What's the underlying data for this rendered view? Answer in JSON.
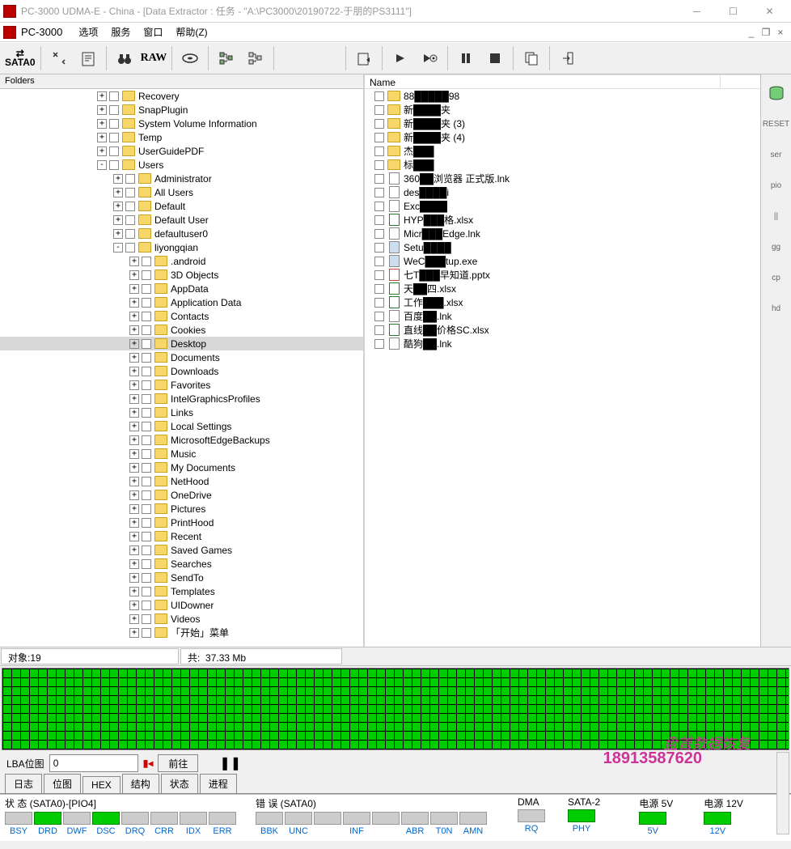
{
  "window": {
    "title": "PC-3000 UDMA-E - China - [Data Extractor : 任务 - \"A:\\PC3000\\20190722-于朋的PS3111\"]"
  },
  "menu": {
    "app_name": "PC-3000",
    "items": [
      "选项",
      "服务",
      "窗口",
      "帮助(Z)"
    ]
  },
  "toolbar": {
    "sata": "SATA0",
    "raw": "RAW"
  },
  "left_pane": {
    "header": "Folders",
    "tree": [
      {
        "indent": 120,
        "exp": "+",
        "label": "Recovery"
      },
      {
        "indent": 120,
        "exp": "+",
        "label": "SnapPlugin"
      },
      {
        "indent": 120,
        "exp": "+",
        "label": "System Volume Information"
      },
      {
        "indent": 120,
        "exp": "+",
        "label": "Temp"
      },
      {
        "indent": 120,
        "exp": "+",
        "label": "UserGuidePDF"
      },
      {
        "indent": 120,
        "exp": "-",
        "label": "Users"
      },
      {
        "indent": 140,
        "exp": "+",
        "label": "Administrator"
      },
      {
        "indent": 140,
        "exp": "+",
        "label": "All Users"
      },
      {
        "indent": 140,
        "exp": "+",
        "label": "Default"
      },
      {
        "indent": 140,
        "exp": "+",
        "label": "Default User"
      },
      {
        "indent": 140,
        "exp": "+",
        "label": "defaultuser0"
      },
      {
        "indent": 140,
        "exp": "-",
        "label": "liyongqian"
      },
      {
        "indent": 160,
        "exp": "+",
        "label": ".android"
      },
      {
        "indent": 160,
        "exp": "+",
        "label": "3D Objects"
      },
      {
        "indent": 160,
        "exp": "+",
        "label": "AppData"
      },
      {
        "indent": 160,
        "exp": "+",
        "label": "Application Data"
      },
      {
        "indent": 160,
        "exp": "+",
        "label": "Contacts"
      },
      {
        "indent": 160,
        "exp": "+",
        "label": "Cookies"
      },
      {
        "indent": 160,
        "exp": "+",
        "label": "Desktop",
        "selected": true
      },
      {
        "indent": 160,
        "exp": "+",
        "label": "Documents"
      },
      {
        "indent": 160,
        "exp": "+",
        "label": "Downloads"
      },
      {
        "indent": 160,
        "exp": "+",
        "label": "Favorites"
      },
      {
        "indent": 160,
        "exp": "+",
        "label": "IntelGraphicsProfiles"
      },
      {
        "indent": 160,
        "exp": "+",
        "label": "Links"
      },
      {
        "indent": 160,
        "exp": "+",
        "label": "Local Settings"
      },
      {
        "indent": 160,
        "exp": "+",
        "label": "MicrosoftEdgeBackups"
      },
      {
        "indent": 160,
        "exp": "+",
        "label": "Music"
      },
      {
        "indent": 160,
        "exp": "+",
        "label": "My Documents"
      },
      {
        "indent": 160,
        "exp": "+",
        "label": "NetHood"
      },
      {
        "indent": 160,
        "exp": "+",
        "label": "OneDrive"
      },
      {
        "indent": 160,
        "exp": "+",
        "label": "Pictures"
      },
      {
        "indent": 160,
        "exp": "+",
        "label": "PrintHood"
      },
      {
        "indent": 160,
        "exp": "+",
        "label": "Recent"
      },
      {
        "indent": 160,
        "exp": "+",
        "label": "Saved Games"
      },
      {
        "indent": 160,
        "exp": "+",
        "label": "Searches"
      },
      {
        "indent": 160,
        "exp": "+",
        "label": "SendTo"
      },
      {
        "indent": 160,
        "exp": "+",
        "label": "Templates"
      },
      {
        "indent": 160,
        "exp": "+",
        "label": "UIDowner"
      },
      {
        "indent": 160,
        "exp": "+",
        "label": "Videos"
      },
      {
        "indent": 160,
        "exp": "+",
        "label": "「开始」菜单"
      }
    ]
  },
  "right_pane": {
    "header": "Name",
    "items": [
      {
        "type": "folder",
        "label": "88█████98"
      },
      {
        "type": "folder",
        "label": "新████夹"
      },
      {
        "type": "folder",
        "label": "新████夹 (3)"
      },
      {
        "type": "folder",
        "label": "新████夹 (4)"
      },
      {
        "type": "folder",
        "label": "杰███"
      },
      {
        "type": "folder",
        "label": "标███"
      },
      {
        "type": "file",
        "label": "360██浏览器 正式版.lnk"
      },
      {
        "type": "file",
        "label": "des████i"
      },
      {
        "type": "file",
        "label": "Exc████"
      },
      {
        "type": "xlsx",
        "label": "HYP███格.xlsx"
      },
      {
        "type": "file",
        "label": "Micr███Edge.lnk"
      },
      {
        "type": "exe",
        "label": "Setu████"
      },
      {
        "type": "exe",
        "label": "WeC███tup.exe"
      },
      {
        "type": "pptx",
        "label": "七T███早知道.pptx"
      },
      {
        "type": "xlsx",
        "label": "天██四.xlsx"
      },
      {
        "type": "xlsx",
        "label": "工作███.xlsx"
      },
      {
        "type": "file",
        "label": "百度██.lnk"
      },
      {
        "type": "xlsx",
        "label": "直线██价格SC.xlsx"
      },
      {
        "type": "file",
        "label": "酷狗██.lnk"
      }
    ]
  },
  "status": {
    "objects_label": "对象:",
    "objects": "19",
    "total_label": "共:",
    "total": "37.33 Mb"
  },
  "lba": {
    "label": "LBA位图",
    "value": "0",
    "go": "前往"
  },
  "tabs": [
    "日志",
    "位图",
    "HEX",
    "结构",
    "状态",
    "进程"
  ],
  "bottom": {
    "status_label": "状 态 (SATA0)-[PIO4]",
    "status_leds": [
      {
        "name": "BSY",
        "on": false
      },
      {
        "name": "DRD",
        "on": true
      },
      {
        "name": "DWF",
        "on": false
      },
      {
        "name": "DSC",
        "on": true
      },
      {
        "name": "DRQ",
        "on": false
      },
      {
        "name": "CRR",
        "on": false
      },
      {
        "name": "IDX",
        "on": false
      },
      {
        "name": "ERR",
        "on": false
      }
    ],
    "error_label": "错 误 (SATA0)",
    "error_leds": [
      {
        "name": "BBK",
        "on": false
      },
      {
        "name": "UNC",
        "on": false
      },
      {
        "name": "",
        "on": false
      },
      {
        "name": "INF",
        "on": false
      },
      {
        "name": "",
        "on": false
      },
      {
        "name": "ABR",
        "on": false
      },
      {
        "name": "T0N",
        "on": false
      },
      {
        "name": "AMN",
        "on": false
      }
    ],
    "dma": {
      "label": "DMA",
      "led": {
        "name": "RQ",
        "on": false
      }
    },
    "sata": {
      "label": "SATA-2",
      "led": {
        "name": "PHY",
        "on": true
      }
    },
    "pwr5": {
      "label": "电源 5V",
      "led": {
        "name": "5V",
        "on": true
      }
    },
    "pwr12": {
      "label": "电源 12V",
      "led": {
        "name": "12V",
        "on": true
      }
    }
  },
  "side_buttons": [
    "db",
    "RESET",
    "ser",
    "pio",
    "||",
    "gg",
    "cp",
    "hd"
  ],
  "watermark": {
    "text": "盘首数据恢复",
    "num": "18913587620"
  }
}
